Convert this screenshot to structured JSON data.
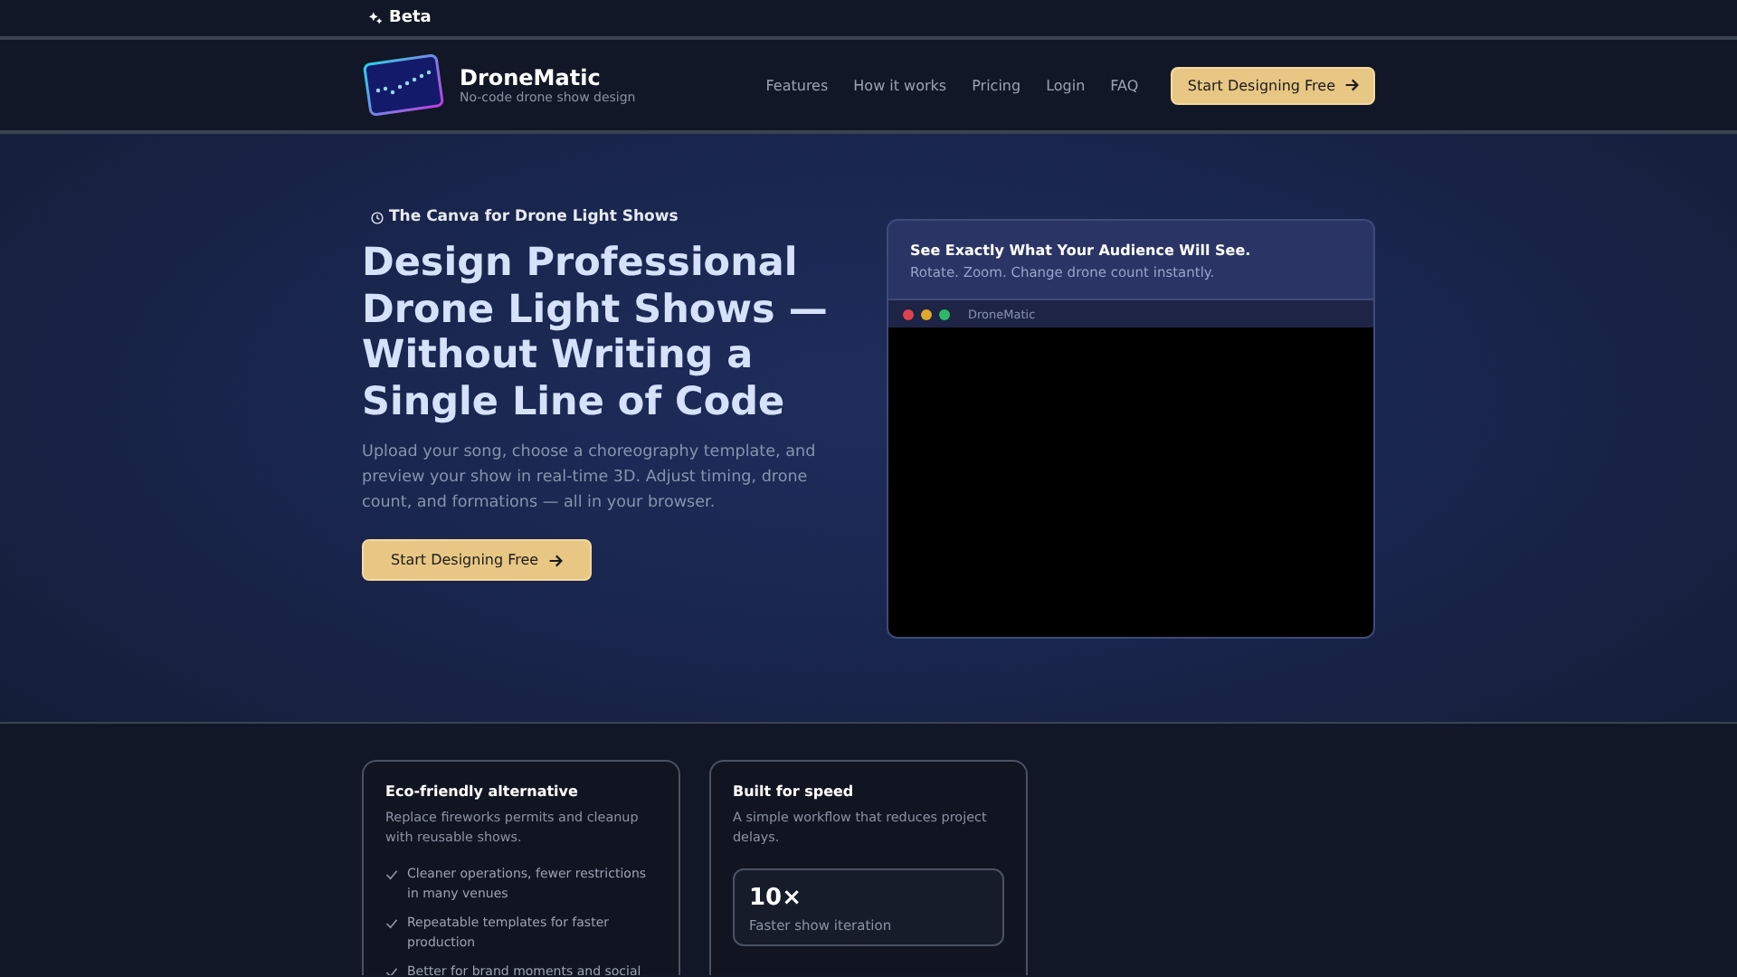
{
  "top_bar": {
    "badge": "Beta"
  },
  "header": {
    "brand": "DroneMatic",
    "tagline": "No-code drone show design",
    "nav": [
      "Features",
      "How it works",
      "Pricing",
      "Login",
      "FAQ"
    ],
    "cta": "Start Designing Free"
  },
  "hero": {
    "eyebrow": "The Canva for Drone Light Shows",
    "title": "Design Professional Drone Light Shows — Without Writing a Single Line of Code",
    "lead": "Upload your song, choose a choreography template, and preview your show in real-time 3D. Adjust timing, drone count, and formations — all in your browser.",
    "cta": "Start Designing Free"
  },
  "preview": {
    "title": "See Exactly What Your Audience Will See.",
    "subtitle": "Rotate. Zoom. Change drone count instantly.",
    "window_title": "DroneMatic",
    "dots": [
      {
        "color": "#e0424f"
      },
      {
        "color": "#e0a82e"
      },
      {
        "color": "#2fb865"
      }
    ]
  },
  "cards": [
    {
      "kind": "list",
      "title": "Eco-friendly alternative",
      "text": "Replace fireworks permits and cleanup with reusable shows.",
      "items": [
        "Cleaner operations, fewer restrictions in many venues",
        "Repeatable templates for faster production",
        "Better for brand moments and social"
      ]
    },
    {
      "kind": "stats",
      "title": "Built for speed",
      "text": "A simple workflow that reduces project delays.",
      "stats": [
        {
          "value": "10×",
          "label": "Faster show iteration"
        }
      ]
    }
  ]
}
